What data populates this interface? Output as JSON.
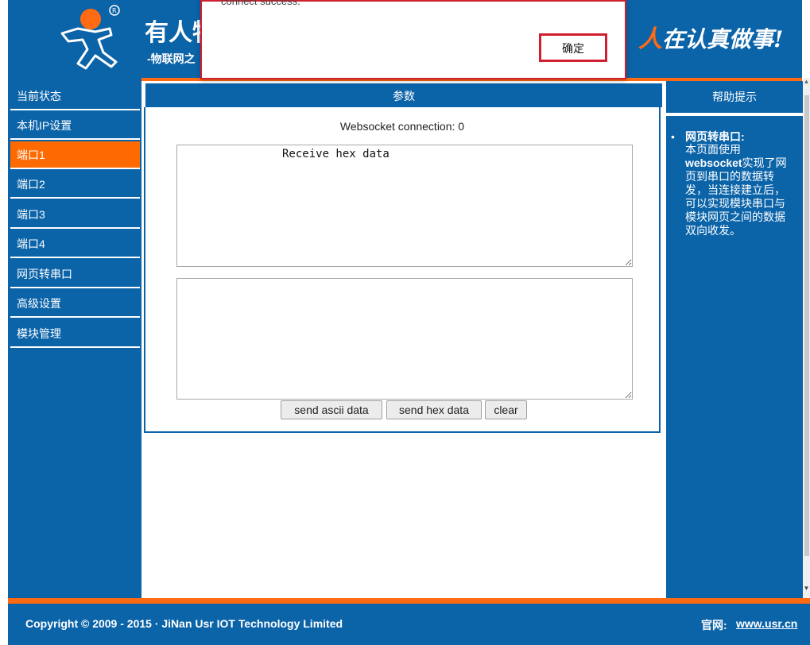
{
  "header": {
    "brand_title": "有人物",
    "brand_sub": "-物联网之",
    "slogan_accent": "人",
    "slogan": "在认真做事!"
  },
  "dialog": {
    "message": "connect success.",
    "ok_label": "确定"
  },
  "nav": {
    "items": [
      {
        "label": "当前状态"
      },
      {
        "label": "本机IP设置"
      },
      {
        "label": "端口1",
        "active": true
      },
      {
        "label": "端口2"
      },
      {
        "label": "端口3"
      },
      {
        "label": "端口4"
      },
      {
        "label": "网页转串口"
      },
      {
        "label": "高级设置"
      },
      {
        "label": "模块管理"
      }
    ]
  },
  "main": {
    "section_title": "参数",
    "ws_status": "Websocket connection: 0",
    "receive_text": "Receive hex data",
    "send_text": "",
    "buttons": {
      "send_ascii": "send ascii data",
      "send_hex": "send hex data",
      "clear": "clear"
    }
  },
  "help": {
    "title": "帮助提示",
    "item_title": "网页转串口:",
    "item_text_1": "本页面使用",
    "item_text_bold": "websocket",
    "item_text_2": "实现了网页到串口的数据转发，当连接建立后，可以实现模块串口与模块网页之间的数据双向收发。"
  },
  "footer": {
    "copyright": "Copyright © 2009 - 2015 · JiNan Usr IOT Technology Limited",
    "site_label": "官网:",
    "site_link": "www.usr.cn"
  },
  "colors": {
    "primary_blue": "#0b63a8",
    "accent_orange": "#ff6a13",
    "dialog_red": "#d01f2e"
  }
}
